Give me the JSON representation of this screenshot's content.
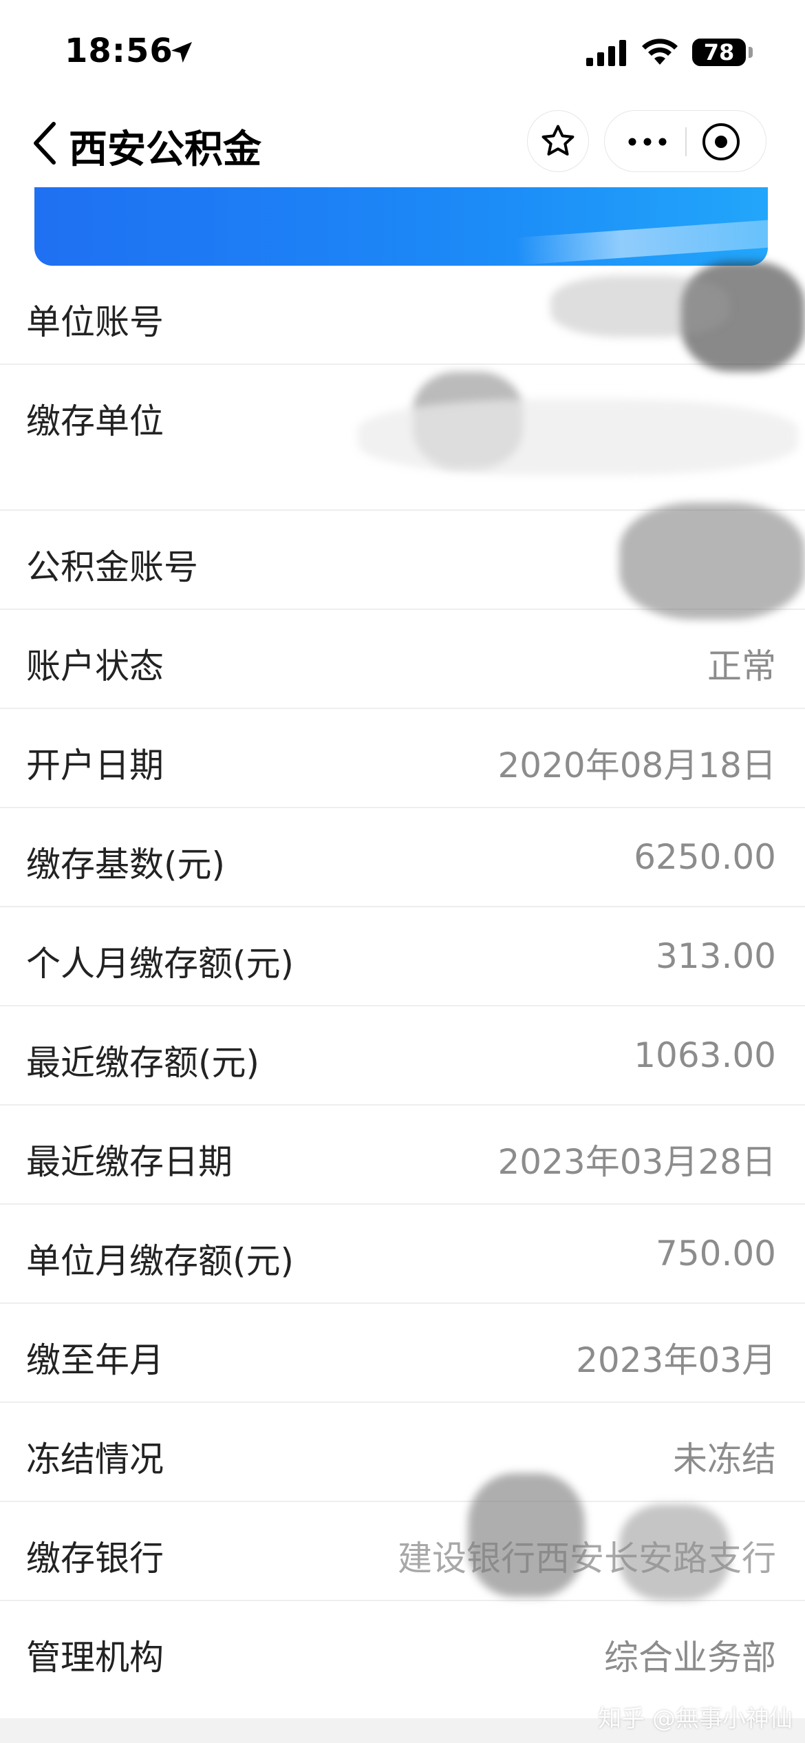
{
  "status_bar": {
    "time": "18:56",
    "battery": "78",
    "icons": [
      "location-arrow-icon",
      "signal-icon",
      "wifi-icon",
      "battery-icon"
    ]
  },
  "nav": {
    "title": "西安公积金",
    "icons": [
      "back-chevron-icon",
      "star-icon",
      "more-dots-icon",
      "target-icon"
    ]
  },
  "rows": [
    {
      "label": "单位账号",
      "value": ""
    },
    {
      "label": "缴存单位",
      "value": ""
    },
    {
      "label": "公积金账号",
      "value": ""
    },
    {
      "label": "账户状态",
      "value": "正常"
    },
    {
      "label": "开户日期",
      "value": "2020年08月18日"
    },
    {
      "label": "缴存基数(元)",
      "value": "6250.00"
    },
    {
      "label": "个人月缴存额(元)",
      "value": "313.00"
    },
    {
      "label": "最近缴存额(元)",
      "value": "1063.00"
    },
    {
      "label": "最近缴存日期",
      "value": "2023年03月28日"
    },
    {
      "label": "单位月缴存额(元)",
      "value": "750.00"
    },
    {
      "label": "缴至年月",
      "value": "2023年03月"
    },
    {
      "label": "冻结情况",
      "value": "未冻结"
    },
    {
      "label": "缴存银行",
      "value": "建设银行西安长安路支行"
    },
    {
      "label": "管理机构",
      "value": "综合业务部"
    }
  ],
  "watermark": "知乎 @無事小神仙"
}
